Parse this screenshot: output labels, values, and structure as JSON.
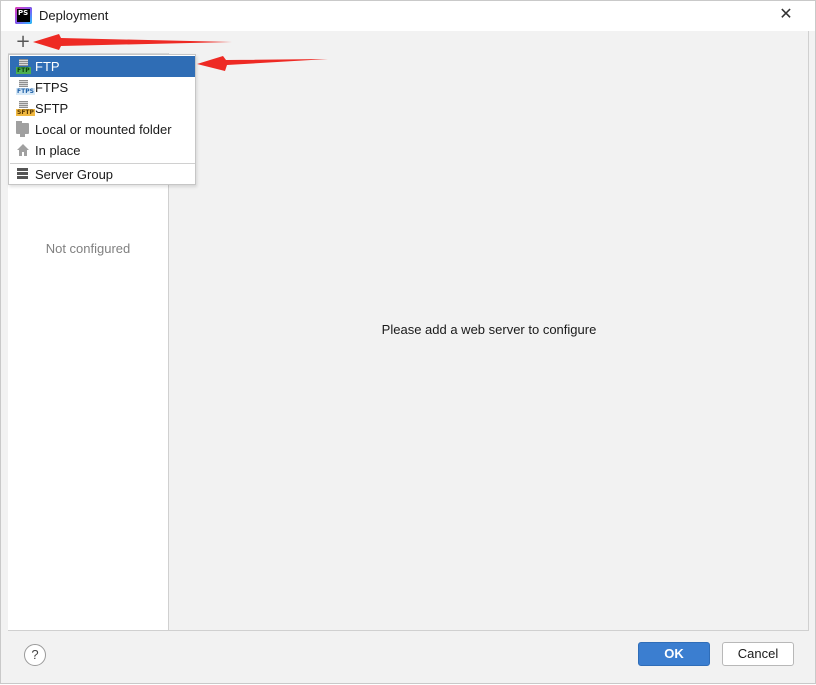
{
  "window": {
    "title": "Deployment",
    "app_icon_text": "PS"
  },
  "toolbar": {
    "add_label": "+"
  },
  "left_panel": {
    "empty_text": "Not configured"
  },
  "right_panel": {
    "hint_text": "Please add a web server to configure"
  },
  "popup": {
    "items": [
      {
        "label": "FTP",
        "icon": "ftp-icon",
        "selected": true
      },
      {
        "label": "FTPS",
        "icon": "ftps-icon",
        "selected": false
      },
      {
        "label": "SFTP",
        "icon": "sftp-icon",
        "selected": false
      },
      {
        "label": "Local or mounted folder",
        "icon": "folder-icon",
        "selected": false
      },
      {
        "label": "In place",
        "icon": "home-icon",
        "selected": false
      }
    ],
    "group_item": {
      "label": "Server Group",
      "icon": "server-group-icon"
    },
    "icon_tags": {
      "ftp": "FTP",
      "ftps": "FTPS",
      "sftp": "SFTP"
    }
  },
  "footer": {
    "help_label": "?",
    "ok_label": "OK",
    "cancel_label": "Cancel"
  },
  "colors": {
    "selection": "#2f6db5",
    "ok_button": "#3b7ed0",
    "annotation_arrow": "#ee2a24"
  }
}
